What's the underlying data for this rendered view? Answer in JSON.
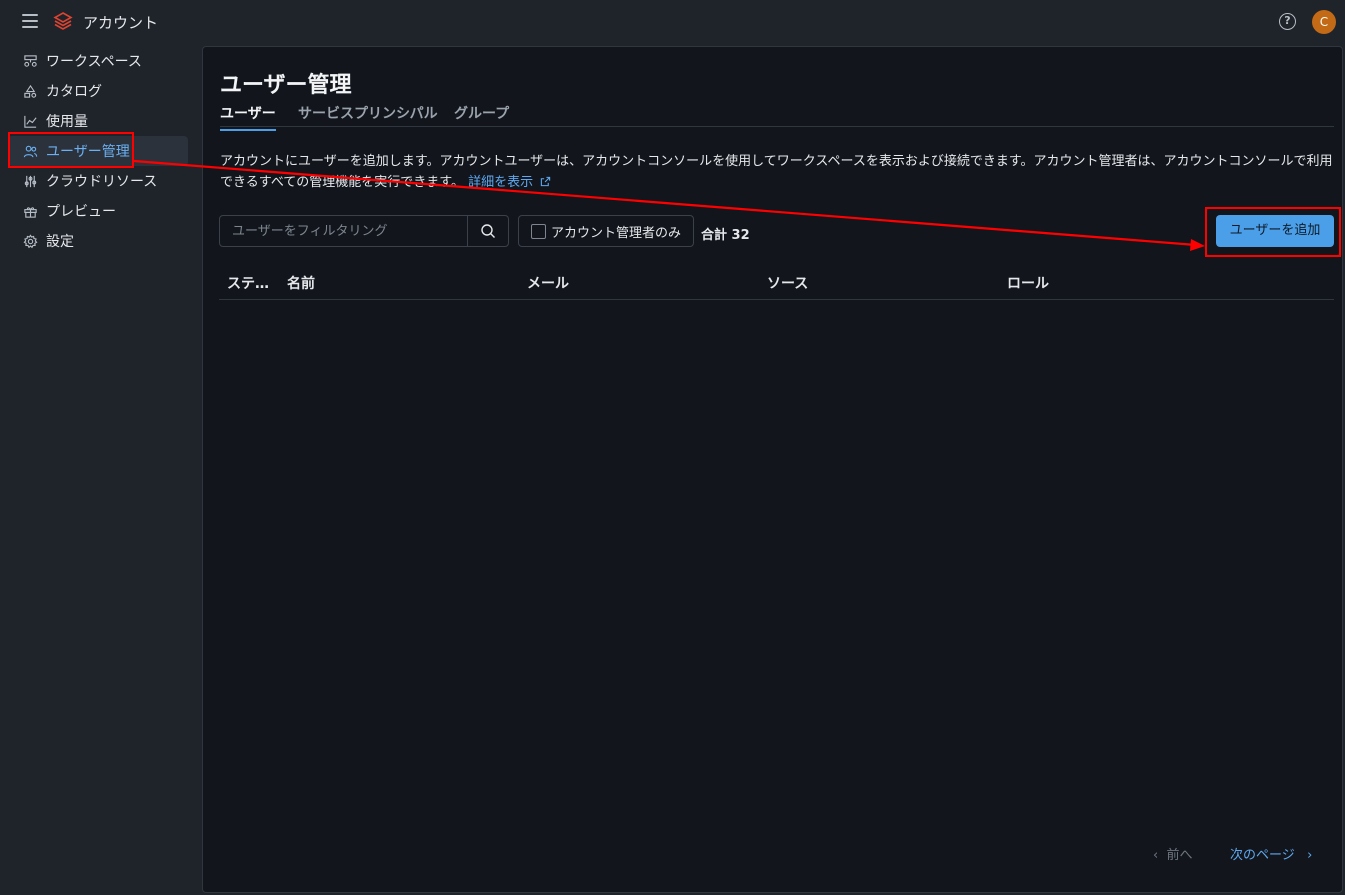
{
  "topbar": {
    "app_title": "アカウント",
    "help_glyph": "?",
    "avatar_initial": "C"
  },
  "sidebar": {
    "items": [
      {
        "label": "ワークスペース",
        "icon": "workspace-icon"
      },
      {
        "label": "カタログ",
        "icon": "catalog-icon"
      },
      {
        "label": "使用量",
        "icon": "usage-chart-icon"
      },
      {
        "label": "ユーザー管理",
        "icon": "users-icon",
        "active": true
      },
      {
        "label": "クラウドリソース",
        "icon": "sliders-icon"
      },
      {
        "label": "プレビュー",
        "icon": "gift-icon"
      },
      {
        "label": "設定",
        "icon": "gear-icon"
      }
    ]
  },
  "main": {
    "title": "ユーザー管理",
    "tabs": [
      {
        "label": "ユーザー",
        "active": true
      },
      {
        "label": "サービスプリンシパル"
      },
      {
        "label": "グループ"
      }
    ],
    "description": "アカウントにユーザーを追加します。アカウントユーザーは、アカウントコンソールを使用してワークスペースを表示および接続できます。アカウント管理者は、アカウントコンソールで利用できるすべての管理機能を実行できます。",
    "learn_more": "詳細を表示",
    "filter": {
      "placeholder": "ユーザーをフィルタリング",
      "value": ""
    },
    "admin_only_label": "アカウント管理者のみ",
    "total_label": "合計 32",
    "add_user_label": "ユーザーを追加",
    "columns": [
      "ステ…",
      "名前",
      "メール",
      "ソース",
      "ロール"
    ],
    "pager": {
      "prev": "前へ",
      "next": "次のページ"
    }
  },
  "colors": {
    "accent": "#4a9fe8",
    "annotation": "#ff0000",
    "avatar": "#c26a16"
  }
}
